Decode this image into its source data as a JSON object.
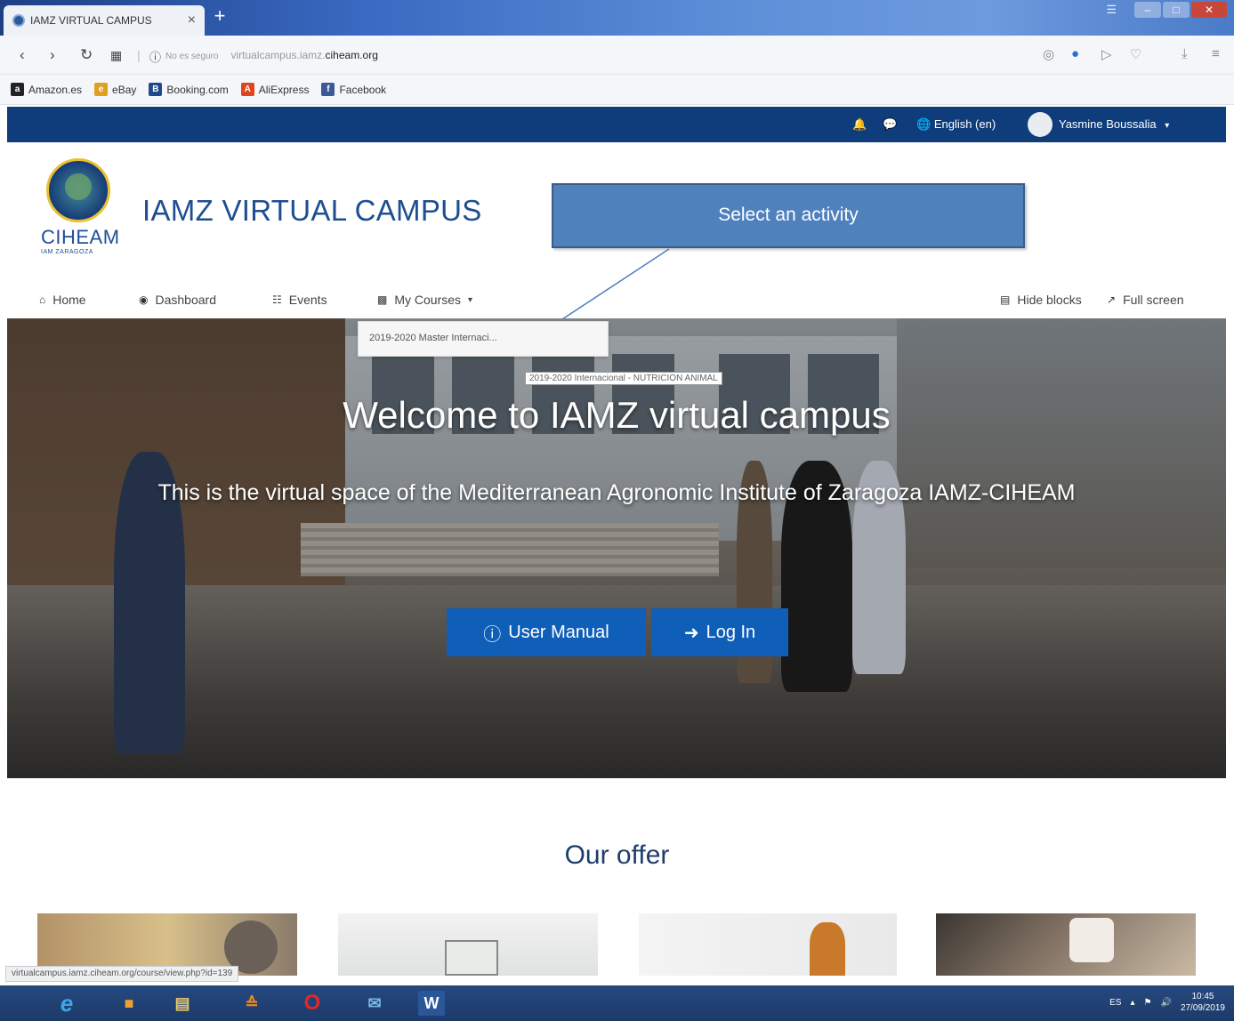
{
  "browser": {
    "tab_title": "IAMZ VIRTUAL CAMPUS",
    "tab_close": "×",
    "new_tab": "+",
    "url_security": "No es seguro",
    "url_prefix": "virtualcampus.iamz.",
    "url_domain": "ciheam.org",
    "status_url": "virtualcampus.iamz.ciheam.org/course/view.php?id=139"
  },
  "bookmarks": [
    {
      "label": "Amazon.es",
      "icon": "a",
      "color": "#222222"
    },
    {
      "label": "eBay",
      "icon": "e",
      "color": "#e0a020"
    },
    {
      "label": "Booking.com",
      "icon": "B",
      "color": "#1e4a8c"
    },
    {
      "label": "AliExpress",
      "icon": "A",
      "color": "#e0461e"
    },
    {
      "label": "Facebook",
      "icon": "f",
      "color": "#3b5998"
    }
  ],
  "site_topbar": {
    "language": "English (en)",
    "user": "Yasmine Boussalia",
    "bg_color": "#0f3c7a"
  },
  "header": {
    "logo_text": "CIHEAM",
    "logo_subtext": "IAM ZARAGOZA",
    "title": "IAMZ VIRTUAL CAMPUS"
  },
  "callout": {
    "text": "Select an activity"
  },
  "main_nav": {
    "home": "Home",
    "dashboard": "Dashboard",
    "events": "Events",
    "my_courses": "My Courses",
    "hide_blocks": "Hide blocks",
    "full_screen": "Full screen"
  },
  "dropdown": {
    "item": "2019-2020 Master Internaci...",
    "tooltip": "2019-2020 Internacional - NUTRICION ANIMAL"
  },
  "hero": {
    "title": "Welcome to IAMZ virtual campus",
    "subtitle": "This is the virtual space of the Mediterranean Agronomic Institute of Zaragoza IAMZ-CIHEAM",
    "btn_manual": "User Manual",
    "btn_login": "Log In",
    "btn_color": "#0f5eb8"
  },
  "offer": {
    "title": "Our offer"
  },
  "taskbar": {
    "lang": "ES",
    "time": "10:45",
    "date": "27/09/2019"
  }
}
